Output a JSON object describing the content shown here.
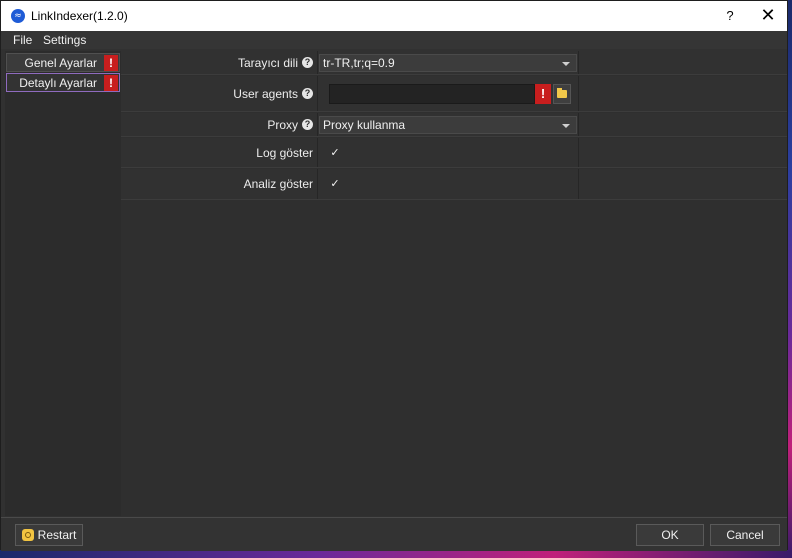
{
  "window": {
    "title": "LinkIndexer(1.2.0)",
    "help_label": "?",
    "close_label": "✕"
  },
  "menu": {
    "items": [
      "File",
      "Settings"
    ]
  },
  "sidebar": {
    "items": [
      {
        "label": "Genel Ayarlar",
        "warn": "!"
      },
      {
        "label": "Detaylı Ayarlar",
        "warn": "!",
        "selected": true
      }
    ]
  },
  "settings": {
    "browser_language": {
      "label": "Tarayıcı dili",
      "value": "tr-TR,tr;q=0.9"
    },
    "user_agents": {
      "label": "User agents",
      "value": "",
      "warn": "!"
    },
    "proxy": {
      "label": "Proxy",
      "value": "Proxy kullanma"
    },
    "show_log": {
      "label": "Log göster",
      "checked": true,
      "mark": "✓"
    },
    "show_analysis": {
      "label": "Analiz göster",
      "checked": true,
      "mark": "✓"
    }
  },
  "footer": {
    "restart_label": "Restart",
    "ok_label": "OK",
    "cancel_label": "Cancel"
  },
  "colors": {
    "window_bg": "#313131",
    "warn": "#c81e1e",
    "selected_border": "#8f6bbf",
    "folder": "#f1c84a"
  },
  "icons": {
    "help": "question-circle-icon",
    "folder": "folder-icon",
    "restart": "restart-icon",
    "app": "app-logo-icon"
  }
}
